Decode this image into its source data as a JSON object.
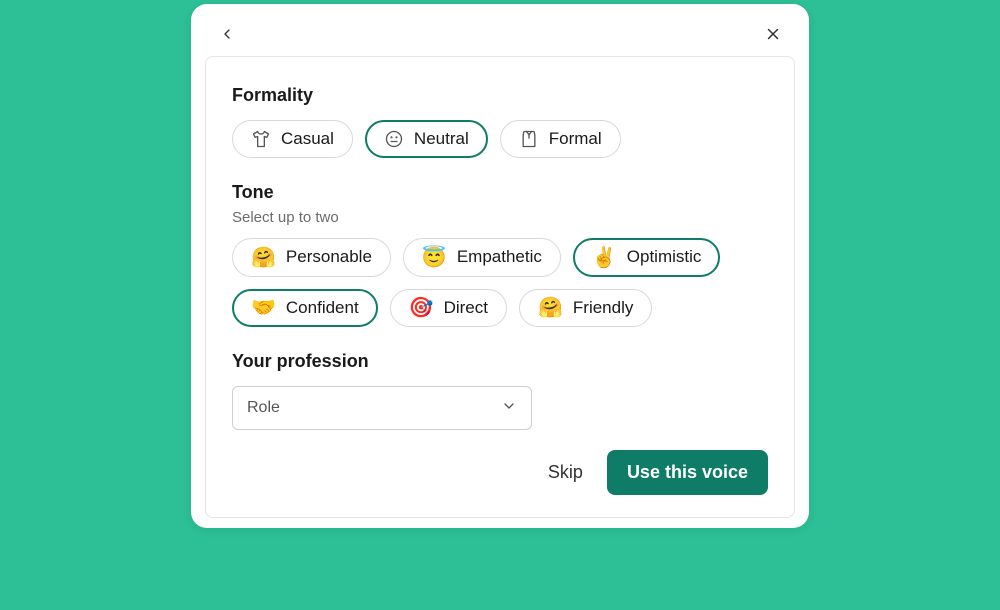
{
  "formality": {
    "title": "Formality",
    "options": [
      {
        "label": "Casual"
      },
      {
        "label": "Neutral"
      },
      {
        "label": "Formal"
      }
    ]
  },
  "tone": {
    "title": "Tone",
    "subtitle": "Select up to two",
    "options": [
      {
        "emoji": "🤗",
        "label": "Personable"
      },
      {
        "emoji": "😇",
        "label": "Empathetic"
      },
      {
        "emoji": "✌️",
        "label": "Optimistic"
      },
      {
        "emoji": "🤝",
        "label": "Confident"
      },
      {
        "emoji": "🎯",
        "label": "Direct"
      },
      {
        "emoji": "🤗",
        "label": "Friendly"
      }
    ]
  },
  "profession": {
    "title": "Your profession",
    "placeholder": "Role"
  },
  "footer": {
    "skip": "Skip",
    "primary": "Use this voice"
  }
}
